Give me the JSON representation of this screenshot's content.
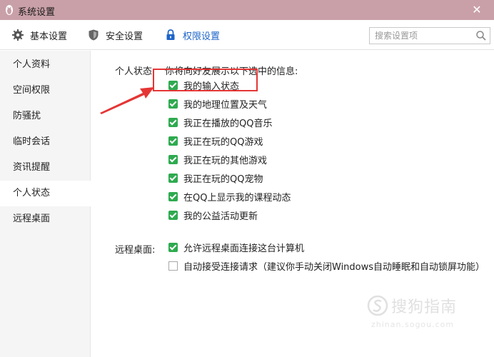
{
  "window": {
    "title": "系统设置",
    "close_glyph": "✕"
  },
  "tabs": [
    {
      "label": "基本设置",
      "icon": "gear-icon"
    },
    {
      "label": "安全设置",
      "icon": "shield-icon"
    },
    {
      "label": "权限设置",
      "icon": "lock-icon",
      "active": true
    }
  ],
  "search": {
    "placeholder": "搜索设置项",
    "value": ""
  },
  "sidebar": {
    "items": [
      {
        "label": "个人资料"
      },
      {
        "label": "空间权限"
      },
      {
        "label": "防骚扰"
      },
      {
        "label": "临时会话"
      },
      {
        "label": "资讯提醒"
      },
      {
        "label": "个人状态",
        "active": true
      },
      {
        "label": "远程桌面"
      }
    ]
  },
  "personal_status": {
    "label": "个人状态:",
    "description": "你将向好友展示以下选中的信息:",
    "options": [
      {
        "label": "我的输入状态",
        "checked": true
      },
      {
        "label": "我的地理位置及天气",
        "checked": true
      },
      {
        "label": "我正在播放的QQ音乐",
        "checked": true
      },
      {
        "label": "我正在玩的QQ游戏",
        "checked": true
      },
      {
        "label": "我正在玩的其他游戏",
        "checked": true
      },
      {
        "label": "我正在玩的QQ宠物",
        "checked": true
      },
      {
        "label": "在QQ上显示我的课程动态",
        "checked": true
      },
      {
        "label": "我的公益活动更新",
        "checked": true
      }
    ]
  },
  "remote_desktop": {
    "label": "远程桌面:",
    "options": [
      {
        "label": "允许远程桌面连接这台计算机",
        "checked": true
      },
      {
        "label": "自动接受连接请求（建议你手动关闭Windows自动睡眠和自动锁屏功能）",
        "checked": false
      }
    ]
  },
  "watermark": {
    "text": "搜狗指南",
    "url": "zhinan.sogou.com"
  },
  "colors": {
    "titlebar": "#c9a0a8",
    "accent": "#1d64c8",
    "checkbox_on": "#2eaa4f",
    "annotation": "#e53535"
  }
}
